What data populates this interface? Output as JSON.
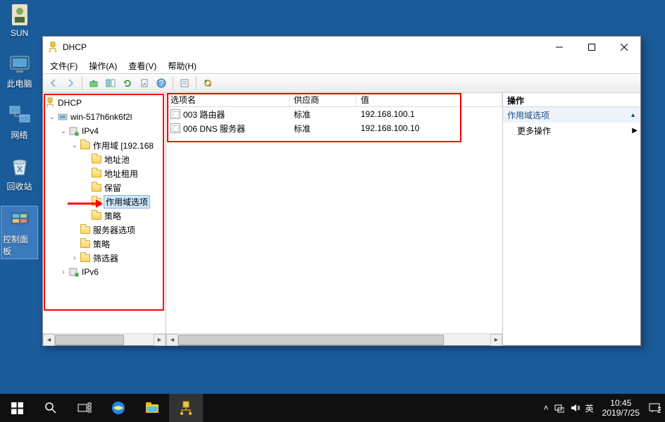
{
  "desktop": {
    "icons": [
      "SUN",
      "此电脑",
      "网络",
      "回收站",
      "控制面板"
    ]
  },
  "window": {
    "title": "DHCP",
    "menus": [
      "文件(F)",
      "操作(A)",
      "查看(V)",
      "帮助(H)"
    ]
  },
  "tree": {
    "root": "DHCP",
    "server": "win-517h6nk6f2l",
    "ipv4": "IPv4",
    "scope": "作用域 [192.168",
    "nodes": {
      "pool": "地址池",
      "leases": "地址租用",
      "reservations": "保留",
      "scope_options": "作用域选项",
      "policies": "策略",
      "server_options": "服务器选项",
      "server_policies": "策略",
      "filters": "筛选器",
      "ipv6": "IPv6"
    }
  },
  "list": {
    "columns": [
      "选项名",
      "供应商",
      "值"
    ],
    "rows": [
      {
        "name": "003 路由器",
        "vendor": "标准",
        "value": "192.168.100.1"
      },
      {
        "name": "006 DNS 服务器",
        "vendor": "标准",
        "value": "192.168.100.10"
      }
    ]
  },
  "actions": {
    "header": "操作",
    "section": "作用域选项",
    "more": "更多操作"
  },
  "taskbar": {
    "ime": "英",
    "time": "10:45",
    "date": "2019/7/25"
  }
}
